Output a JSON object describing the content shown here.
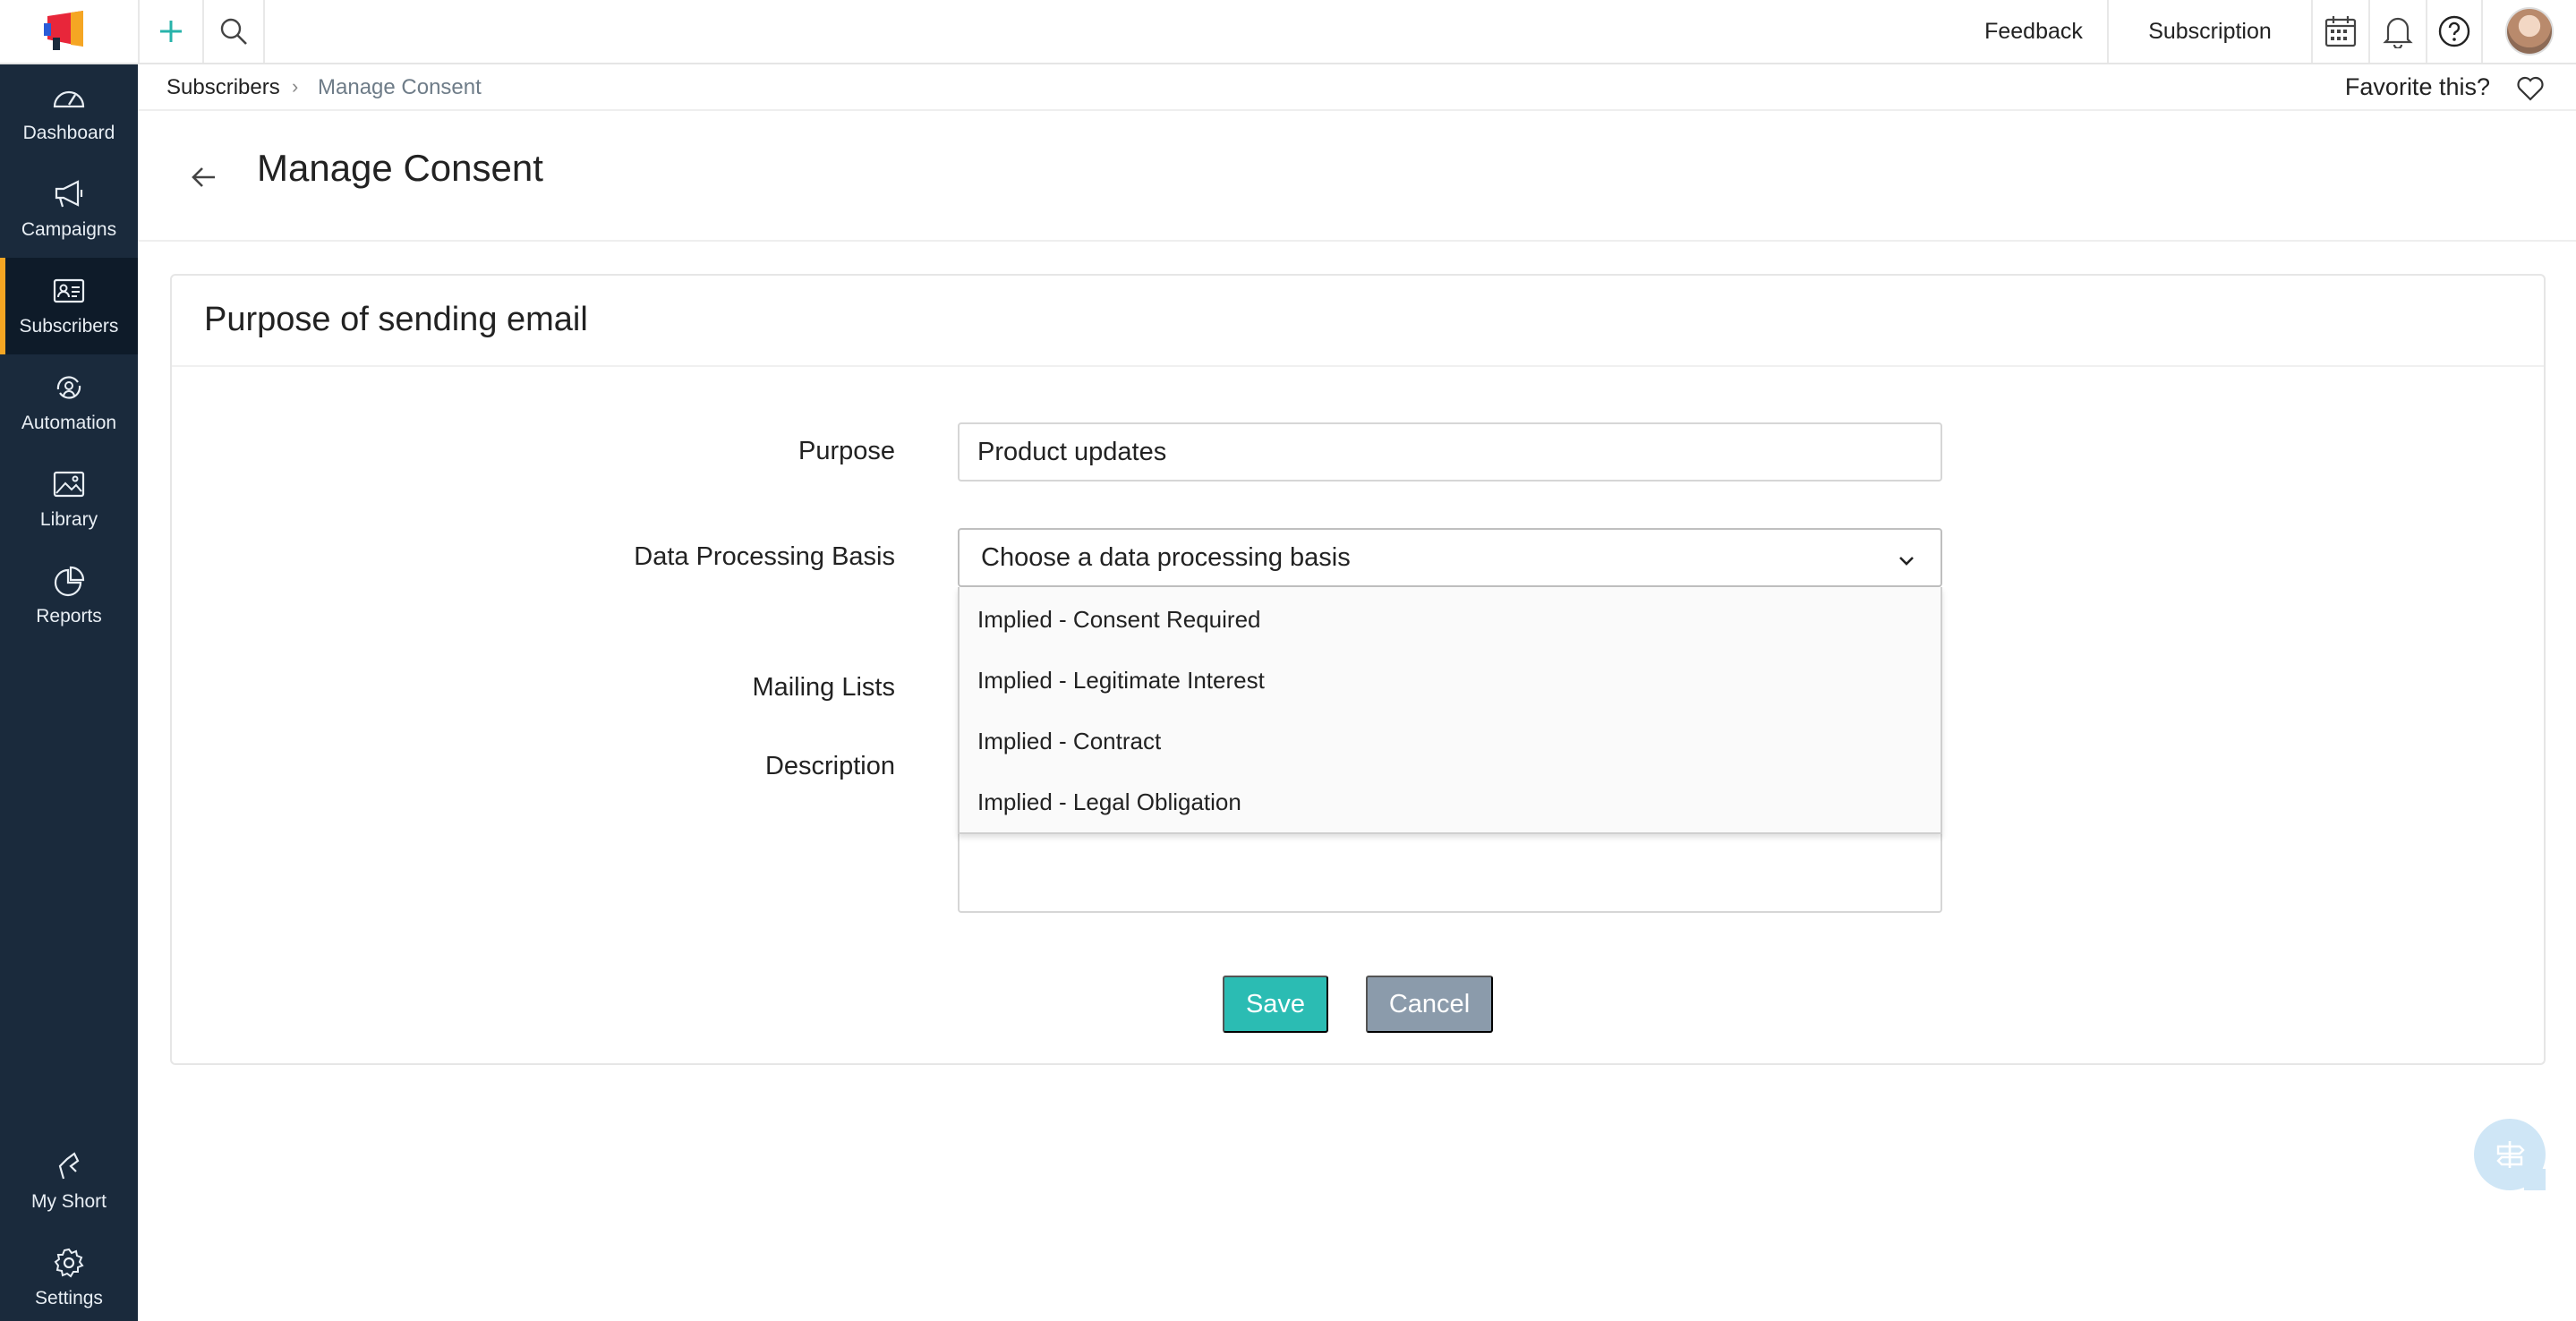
{
  "topbar": {
    "feedback": "Feedback",
    "subscription": "Subscription"
  },
  "sidebar": {
    "items": [
      {
        "label": "Dashboard"
      },
      {
        "label": "Campaigns"
      },
      {
        "label": "Subscribers"
      },
      {
        "label": "Automation"
      },
      {
        "label": "Library"
      },
      {
        "label": "Reports"
      }
    ],
    "bottom": [
      {
        "label": "My Short"
      },
      {
        "label": "Settings"
      }
    ],
    "active": "Subscribers"
  },
  "breadcrumb": {
    "parent": "Subscribers",
    "separator": "›",
    "current": "Manage Consent",
    "favorite": "Favorite this?"
  },
  "page": {
    "title": "Manage Consent"
  },
  "card": {
    "title": "Purpose of sending email"
  },
  "form": {
    "purpose_label": "Purpose",
    "purpose_value": "Product updates",
    "basis_label": "Data Processing Basis",
    "basis_placeholder": "Choose a data processing basis",
    "basis_options": [
      "Implied - Consent Required",
      "Implied - Legitimate Interest",
      "Implied - Contract",
      "Implied - Legal Obligation"
    ],
    "lists_label": "Mailing Lists",
    "description_label": "Description",
    "save": "Save",
    "cancel": "Cancel"
  },
  "colors": {
    "sidebar_bg": "#1a2a3c",
    "active_accent": "#f5a623",
    "primary": "#2bbcb3",
    "cancel": "#8b9bab"
  }
}
